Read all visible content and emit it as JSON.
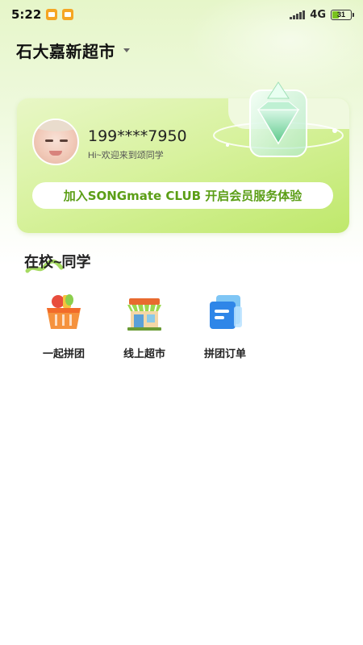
{
  "status_bar": {
    "time": "5:22",
    "network": "4G",
    "battery": "31"
  },
  "store": {
    "name": "石大嘉新超市"
  },
  "member_card": {
    "phone": "199****7950",
    "welcome": "Hi~欢迎来到颂同学",
    "join_button": "加入SONGmate CLUB 开启会员服务体验"
  },
  "section": {
    "title": "在校~同学"
  },
  "grid": [
    {
      "label": "一起拼团",
      "icon": "basket-icon"
    },
    {
      "label": "线上超市",
      "icon": "store-icon"
    },
    {
      "label": "拼团订单",
      "icon": "order-icon"
    }
  ],
  "colors": {
    "accent_green": "#5b9e16",
    "card_green": "#bfe86b",
    "notification_orange": "#f5a623"
  }
}
